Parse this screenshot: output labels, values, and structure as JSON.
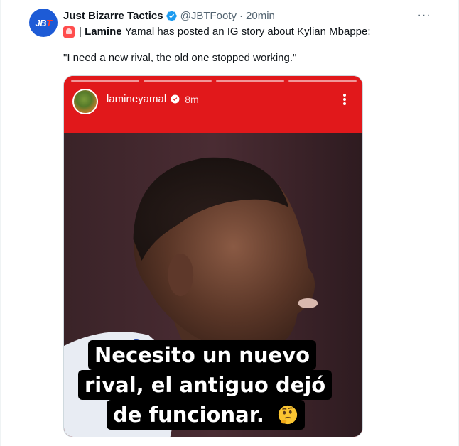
{
  "tweet": {
    "author_name": "Just Bizarre Tactics",
    "handle": "@JBTFooty",
    "separator": "·",
    "time": "20min",
    "avatar_text_j": "JB",
    "avatar_text_t": "T",
    "more_label": "···",
    "line1_bar": "|",
    "line1_bold": "Lamine",
    "line1_rest": "Yamal has posted an IG story about Kylian Mbappe:",
    "quote": "\"I need a new rival, the old one stopped working.\""
  },
  "story": {
    "username": "lamineyamal",
    "time": "8m",
    "caption_lines": [
      "Necesito un nuevo",
      "rival, el antiguo dejó",
      "de funcionar."
    ]
  },
  "colors": {
    "verified": "#1d9bf0",
    "story_bar": "#e1181b",
    "avatar_bg": "#1d5bd6"
  }
}
